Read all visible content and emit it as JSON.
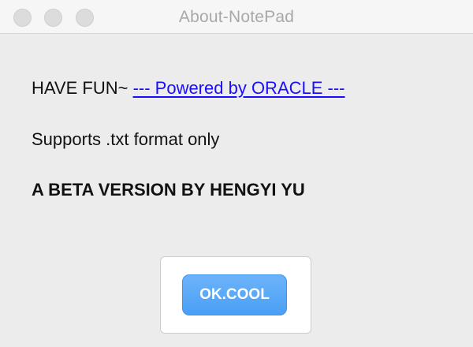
{
  "window": {
    "title": "About-NotePad"
  },
  "content": {
    "line1_prefix": "HAVE FUN~ ",
    "line1_link": "--- Powered by ORACLE --- ",
    "line2": "Supports .txt format only",
    "line3": "A BETA VERSION BY HENGYI YU"
  },
  "actions": {
    "ok_label": "OK.COOL"
  },
  "icons": {
    "close": "close-icon",
    "minimize": "minimize-icon",
    "zoom": "zoom-icon"
  },
  "colors": {
    "link": "#1a0dff",
    "button_accent": "#4a9ff5",
    "window_bg": "#ececec"
  }
}
